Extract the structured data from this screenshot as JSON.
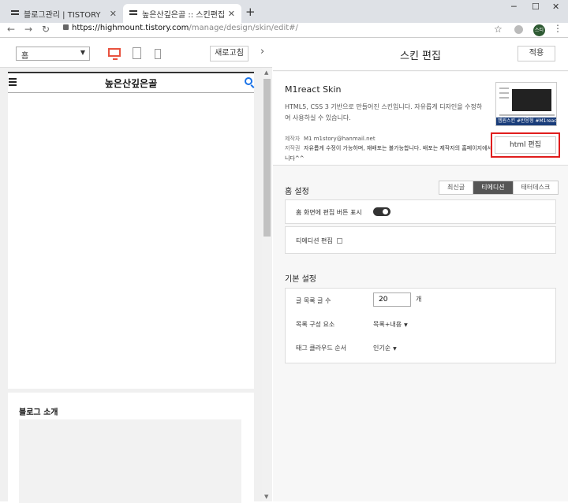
{
  "browser": {
    "tabs": [
      {
        "title": "블로그관리 | TISTORY"
      },
      {
        "title": "높은산깊은골 :: 스킨편집"
      }
    ],
    "new_tab": "+",
    "window_controls": {
      "minimize": "─",
      "maximize": "☐",
      "close": "✕"
    },
    "nav": {
      "back": "←",
      "forward": "→",
      "reload": "↻"
    },
    "url_host": "https://highmount.tistory.com",
    "url_path": "/manage/design/skin/edit#/",
    "star": "☆",
    "avatar_text": "스티",
    "kebab": "⋮"
  },
  "left_toolbar": {
    "page_select": "홈",
    "refresh_label": "새로고침",
    "collapse": "›"
  },
  "preview": {
    "blog_title": "높은산깊은골",
    "widget_title": "블로그 소개"
  },
  "editor": {
    "title": "스킨 편집",
    "apply_label": "적용",
    "skin": {
      "name": "M1react Skin",
      "description": "HTML5, CSS 3 기반으로 만들어진 스킨입니다. 자유롭게 디자인을 수정하여 사용하실 수 있습니다.",
      "author_key": "제작자",
      "author_name": "M1",
      "author_email": "m1story@hanmail.net",
      "rights_key": "저작권",
      "rights_text": "자유롭게 수정이 가능하며, 재배포는 불가능합니다. 배포는 제작자의 홈페이지에서만 합니다^^",
      "thumb_label": "엠원스킨 #반응형 #M1react",
      "html_edit_label": "html 편집"
    },
    "home_settings": {
      "title": "홈 설정",
      "tabs": [
        "최신글",
        "티에디션",
        "태터데스크"
      ],
      "active_tab": 1,
      "edit_button_row_label": "홈 화면에 편집 버튼 표시",
      "toggle_on": true,
      "tedition_edit_label": "티에디션 편집"
    },
    "basic_settings": {
      "title": "기본 설정",
      "post_count_label": "글 목록 글 수",
      "post_count_value": "20",
      "post_count_unit": "개",
      "list_component_label": "목록 구성 요소",
      "list_component_value": "목록+내용",
      "tag_cloud_label": "태그 클라우드 순서",
      "tag_cloud_value": "인기순"
    }
  }
}
